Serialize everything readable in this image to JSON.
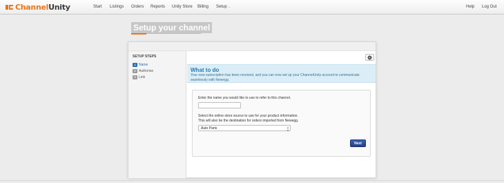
{
  "app": {
    "logo_part1": "Channel",
    "logo_part2": "Unity",
    "accent_color": "#e8771c",
    "primary_color": "#2e6eb5"
  },
  "nav": {
    "items": [
      {
        "label": "Start"
      },
      {
        "label": "Listings"
      },
      {
        "label": "Orders"
      },
      {
        "label": "Reports"
      },
      {
        "label": "Unity Store"
      },
      {
        "label": "Billing"
      },
      {
        "label": "Setup",
        "chevron": "⌄"
      }
    ],
    "right_items": [
      {
        "label": "Help"
      },
      {
        "label": "Log Out"
      }
    ]
  },
  "page": {
    "title": "Setup your channel"
  },
  "sidebar": {
    "heading": "SETUP STEPS",
    "steps": [
      {
        "number": "1",
        "label": "Name",
        "active": true
      },
      {
        "number": "2",
        "label": "Authorise",
        "active": false
      },
      {
        "number": "3",
        "label": "Link",
        "active": false
      }
    ]
  },
  "toolbar": {
    "settings_icon": "gear-icon"
  },
  "info": {
    "title": "What to do",
    "text": "Your new subscription has been received, and you can now set up your ChannelUnity account to communicate seamlessly with Newegg."
  },
  "form": {
    "name_label": "Enter the name you would like to use to refer to this channel.",
    "name_value": "",
    "source_label_line1": "Select the online store source to use for your product information.",
    "source_label_line2": "This will also be the destination for orders imported from Newegg.",
    "source_selected": "Auto Parts",
    "next_label": "Next"
  }
}
